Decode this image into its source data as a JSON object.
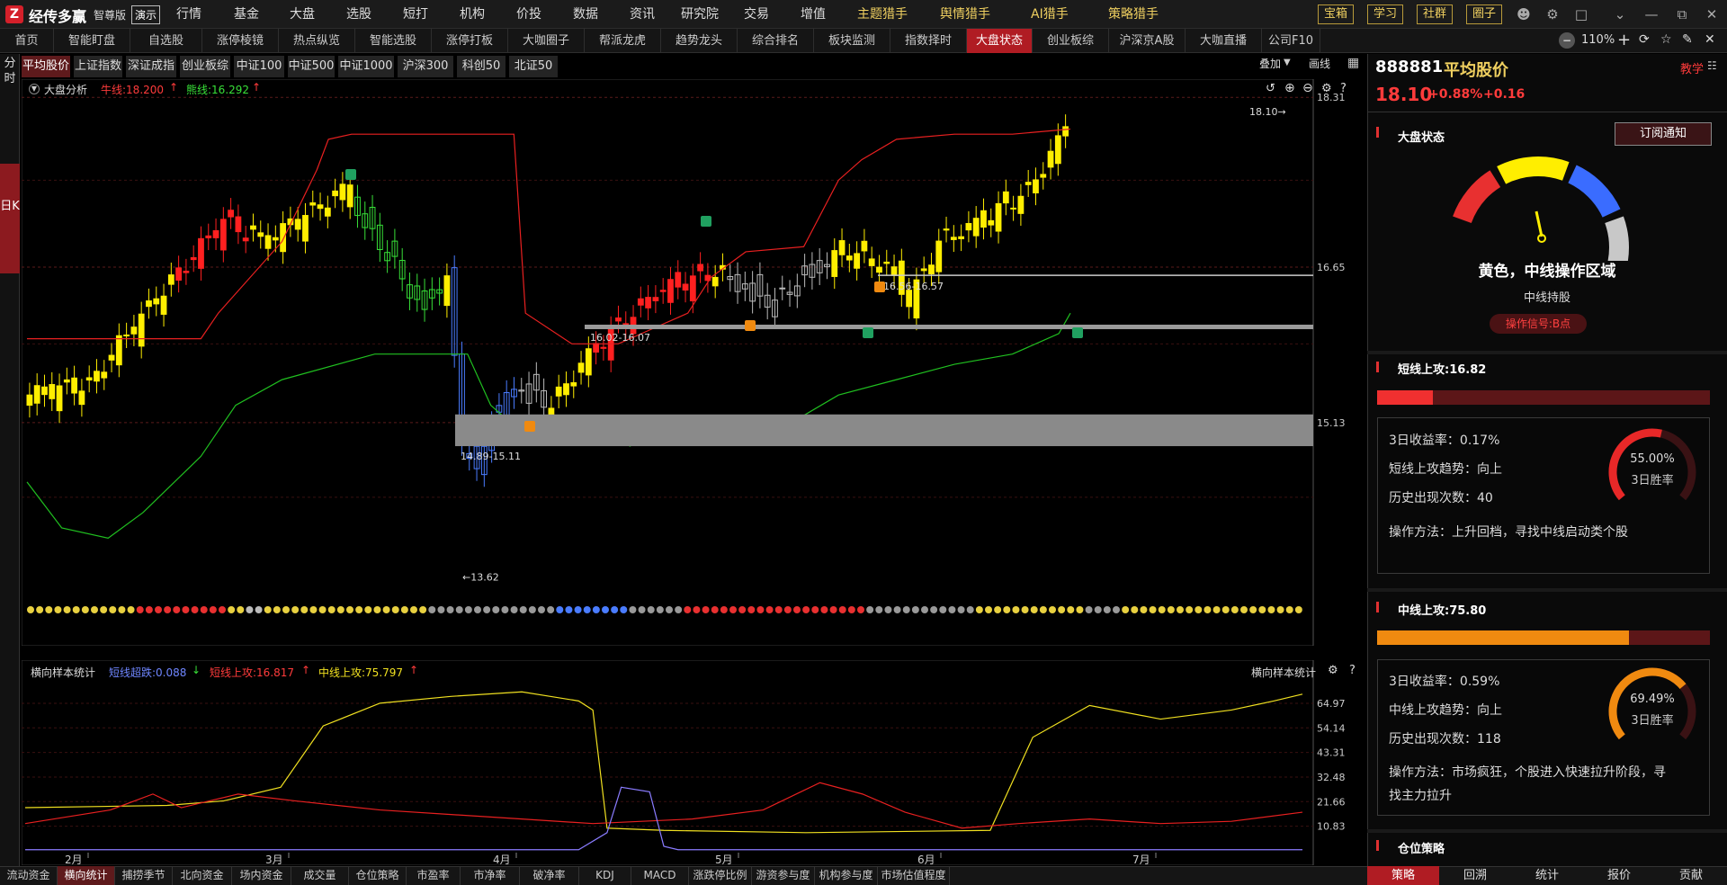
{
  "app": {
    "name": "经传多赢",
    "edition": "智尊版",
    "demo": "演示"
  },
  "topmenu": [
    "行情",
    "基金",
    "大盘",
    "选股",
    "短打",
    "机构",
    "价投",
    "数据",
    "资讯",
    "研究院",
    "交易",
    "增值"
  ],
  "topmenu_gold": [
    "主题猎手",
    "舆情猎手",
    "AI猎手",
    "策略猎手"
  ],
  "topbuttons": [
    "宝箱",
    "学习",
    "社群",
    "圈子"
  ],
  "navtabs": [
    "首页",
    "智能盯盘",
    "自选股",
    "涨停棱镜",
    "热点纵览",
    "智能选股",
    "涨停打板",
    "大咖圈子",
    "帮派龙虎",
    "趋势龙头",
    "综合排名",
    "板块监测",
    "指数择时",
    "大盘状态",
    "创业板综",
    "沪深京A股",
    "大咖直播",
    "公司F10"
  ],
  "navtab_active": "大盘状态",
  "zoom": "110%",
  "period": {
    "fen": "分时",
    "ri": "日K"
  },
  "index_tabs": [
    "平均股价",
    "上证指数",
    "深证成指",
    "创业板综",
    "中证100",
    "中证500",
    "中证1000",
    "沪深300",
    "科创50",
    "北证50"
  ],
  "index_tab_active": "平均股价",
  "toolbar": {
    "overlay": "叠加",
    "draw": "画线"
  },
  "main_chart": {
    "title": "大盘分析",
    "niu_line": "牛线:18.200",
    "xiong_line": "熊线:16.292",
    "y_labels": [
      "18.31",
      "16.65",
      "15.13"
    ],
    "zone_labels": [
      "16.02-16.07",
      "14.89-15.11",
      "16.56-16.57"
    ],
    "low_label": "13.62",
    "high_label": "18.10",
    "months": [
      "2月",
      "3月",
      "4月",
      "5月",
      "6月",
      "7月"
    ]
  },
  "indicator": {
    "title": "横向样本统计",
    "blue": "短线超跌:0.088",
    "red": "短线上攻:16.817",
    "yellow": "中线上攻:75.797",
    "right_title": "横向样本统计",
    "y_labels": [
      "64.97",
      "54.14",
      "43.31",
      "32.48",
      "21.66",
      "10.83"
    ]
  },
  "bottom_tabs": [
    "流动资金",
    "横向统计",
    "捕捞季节",
    "北向资金",
    "场内资金",
    "成交量",
    "仓位策略",
    "市盈率",
    "市净率",
    "破净率",
    "KDJ",
    "MACD",
    "涨跌停比例",
    "游资参与度",
    "机构参与度",
    "市场估值程度"
  ],
  "bottom_tab_active": "横向统计",
  "right": {
    "code": "888881",
    "name": "平均股价",
    "teach": "教学",
    "price": "18.10",
    "pct": "+0.88%",
    "chg": "+0.16",
    "market_state_title": "大盘状态",
    "subscribe": "订阅通知",
    "gauge_caption": "黄色，中线操作区域",
    "gauge_sub": "中线持股",
    "signal": "操作信号:B点",
    "short": {
      "title": "短线上攻:16.82",
      "bar_fraction": 0.1682,
      "lines": [
        "3日收益率：0.17%",
        "短线上攻趋势：向上",
        "历史出现次数：40",
        "操作方法：上升回档，寻找中线启动类个股"
      ],
      "win_pct": "55.00%",
      "win_label": "3日胜率",
      "win_value": 0.55
    },
    "mid": {
      "title": "中线上攻:75.80",
      "bar_fraction": 0.758,
      "lines": [
        "3日收益率：0.59%",
        "中线上攻趋势：向上",
        "历史出现次数：118",
        "操作方法：市场疯狂，个股进入快速拉升阶段，寻",
        "找主力拉升"
      ],
      "win_pct": "69.49%",
      "win_label": "3日胜率",
      "win_value": 0.6949
    },
    "position_title": "仓位策略",
    "tabs": [
      "策略",
      "回溯",
      "统计",
      "报价",
      "贡献"
    ],
    "tab_active": "策略"
  },
  "colors": {
    "accent": "#b01c23",
    "gold": "#f0d060",
    "up": "#ff3b3b",
    "down": "#38e038",
    "yellow": "#f0e020",
    "blue": "#4a7cff"
  }
}
